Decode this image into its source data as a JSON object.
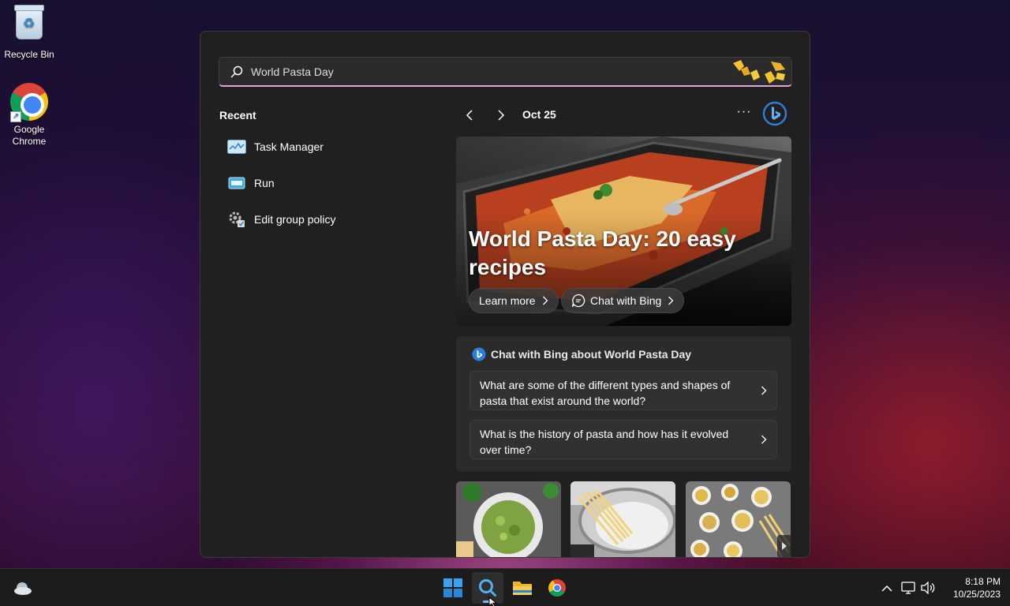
{
  "desktop": {
    "icons": [
      {
        "label": "Recycle Bin",
        "icon": "recycle-bin-icon"
      },
      {
        "label": "Google Chrome",
        "icon": "chrome-icon"
      }
    ]
  },
  "search": {
    "value": "World Pasta Day",
    "icon": "search-icon"
  },
  "recent": {
    "title": "Recent",
    "items": [
      {
        "label": "Task Manager",
        "icon": "task-manager-icon"
      },
      {
        "label": "Run",
        "icon": "run-icon"
      },
      {
        "label": "Edit group policy",
        "icon": "group-policy-icon"
      }
    ]
  },
  "feed": {
    "date": "Oct 25",
    "more_label": "···",
    "hero": {
      "title": "World Pasta Day: 20 easy recipes",
      "learn_more": "Learn more",
      "chat_with_bing": "Chat with Bing"
    },
    "chat": {
      "heading": "Chat with Bing about World Pasta Day",
      "questions": [
        "What are some of the different types and shapes of pasta that exist around the world?",
        "What is the history of pasta and how has it evolved over time?"
      ]
    },
    "thumbnails": [
      "pesto-pasta-image",
      "boiling-spaghetti-image",
      "assorted-pasta-bowls-image"
    ]
  },
  "taskbar": {
    "apps": [
      "start-icon",
      "search-icon",
      "file-explorer-icon",
      "chrome-icon"
    ],
    "clock": {
      "time": "8:18 PM",
      "date": "10/25/2023"
    }
  },
  "colors": {
    "accent": "#e6a5d8",
    "panel_bg": "#202020",
    "bing_blue": "#2c7fd8"
  }
}
